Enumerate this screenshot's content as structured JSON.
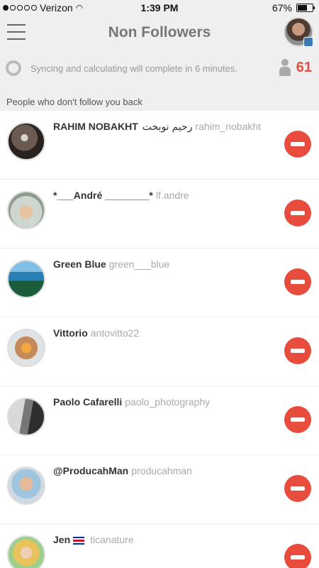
{
  "status_bar": {
    "carrier": "Verizon",
    "time": "1:39 PM",
    "battery": "67%",
    "battery_level": 0.67
  },
  "header": {
    "title": "Non Followers",
    "menu_icon": "hamburger-icon",
    "profile_icon": "instagram-badge-icon"
  },
  "sync": {
    "text": "Syncing and calculating will complete in 6 minutes.",
    "count": "61",
    "count_color": "#e74c3c"
  },
  "section": {
    "title": "People who don't follow you back"
  },
  "users": [
    {
      "name": "RAHIM NOBAKHT",
      "extra": "رحیم نوبخت",
      "handle": "rahim_nobakht",
      "avatar": "radial-gradient(circle at 45% 40%, #d9d0c8 0 12%, #6b5a52 13% 45%, #2a2220 46%)"
    },
    {
      "name": "*___André ________*",
      "extra": "",
      "handle": "lf.andre",
      "avatar": "radial-gradient(circle at 50% 55%, #e8c4a0 0 25%, #cfd6cf 26% 60%, #8d9b8c 61%)"
    },
    {
      "name": "Green Blue",
      "extra": "",
      "handle": "green___blue",
      "avatar": "linear-gradient(#7fbfe6 0 30%, #2a7fb5 30% 55%, #1d5c3a 55%)"
    },
    {
      "name": "Vittorio",
      "extra": "",
      "handle": "antovitto22",
      "avatar": "radial-gradient(circle at 50% 50%, #f4a640 0 20%, #c58a5a 21% 45%, #dfe3e6 46%)"
    },
    {
      "name": "Paolo Cafarelli",
      "extra": "",
      "handle": "paolo_photography",
      "avatar": "linear-gradient(100deg, #d8d8d8 0 40%, #777 41% 60%, #2e2e2e 61%)"
    },
    {
      "name": "@ProducahMan",
      "extra": "",
      "handle": "producahman",
      "avatar": "radial-gradient(circle at 50% 45%, #e6b99a 0 25%, #9fc4de 26% 55%, #cfd9e2 56%)"
    },
    {
      "name": "Jen",
      "extra": "",
      "handle": "ticanature",
      "avatar": "radial-gradient(circle at 50% 45%, #f0d0b4 0 22%, #e8c25a 23% 50%, #9ccf8c 51%)",
      "flag": "costa-rica-flag-icon"
    }
  ]
}
